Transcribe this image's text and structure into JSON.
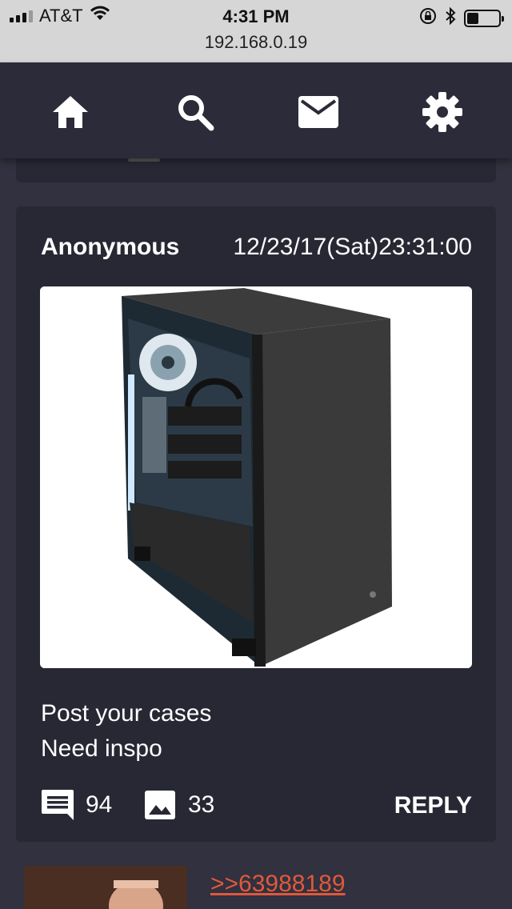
{
  "status_bar": {
    "carrier": "AT&T",
    "time": "4:31 PM",
    "url": "192.168.0.19",
    "icons": [
      "signal-icon",
      "wifi-icon",
      "orientation-lock-icon",
      "bluetooth-icon",
      "battery-icon"
    ]
  },
  "nav": {
    "items": [
      {
        "icon": "home-icon"
      },
      {
        "icon": "search-icon"
      },
      {
        "icon": "mail-icon"
      },
      {
        "icon": "gear-icon"
      }
    ]
  },
  "post": {
    "author": "Anonymous",
    "date": "12/23/17(Sat)23:31:00",
    "image_alt": "pc-case-image",
    "body_lines": [
      "Post your cases",
      "Need inspo"
    ],
    "replies": "94",
    "images": "33",
    "reply_label": "REPLY"
  },
  "next_post": {
    "link": ">>63988189"
  },
  "colors": {
    "background": "#31313f",
    "card": "#282835",
    "nav": "#2b2b39",
    "link": "#e0593b"
  }
}
